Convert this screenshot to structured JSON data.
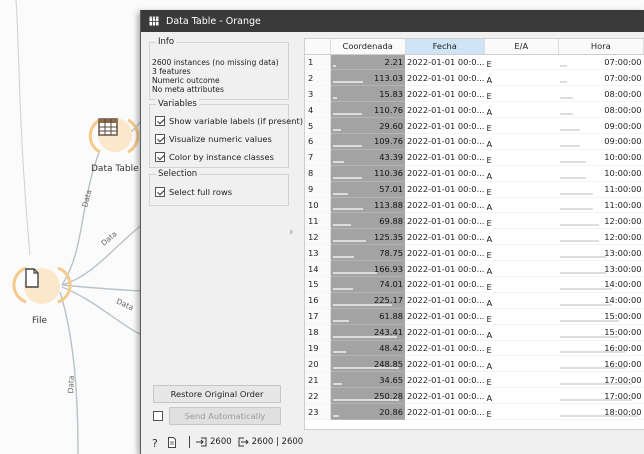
{
  "window": {
    "title": "Data Table - Orange"
  },
  "canvas": {
    "nodes": [
      {
        "label": "Data Table"
      },
      {
        "label": "File"
      }
    ],
    "link_label": "Data"
  },
  "info": {
    "title": "Info",
    "lines": [
      "2600 instances (no missing data)",
      "3 features",
      "Numeric outcome",
      "No meta attributes"
    ]
  },
  "variables": {
    "title": "Variables",
    "options": [
      {
        "label": "Show variable labels (if present)",
        "checked": true
      },
      {
        "label": "Visualize numeric values",
        "checked": true
      },
      {
        "label": "Color by instance classes",
        "checked": true
      }
    ]
  },
  "selection": {
    "title": "Selection",
    "options": [
      {
        "label": "Select full rows",
        "checked": true
      }
    ]
  },
  "buttons": {
    "restore": "Restore Original Order",
    "send": "Send Automatically",
    "send_checked": false
  },
  "status": {
    "input": "2600",
    "output": "2600 | 2600"
  },
  "table": {
    "columns": [
      "Coordenada",
      "Fecha",
      "E/A",
      "Hora"
    ],
    "sorted_column": "Fecha",
    "rows": [
      {
        "n": "1",
        "coord": "2.21",
        "cval": 2.21,
        "fecha": "2022-01-01 00:0...",
        "ea": "E",
        "hora": "07:00:00",
        "hval": 7
      },
      {
        "n": "2",
        "coord": "113.03",
        "cval": 113.03,
        "fecha": "2022-01-01 00:0...",
        "ea": "A",
        "hora": "07:00:00",
        "hval": 7
      },
      {
        "n": "3",
        "coord": "15.83",
        "cval": 15.83,
        "fecha": "2022-01-01 00:0...",
        "ea": "E",
        "hora": "08:00:00",
        "hval": 8
      },
      {
        "n": "4",
        "coord": "110.76",
        "cval": 110.76,
        "fecha": "2022-01-01 00:0...",
        "ea": "A",
        "hora": "08:00:00",
        "hval": 8
      },
      {
        "n": "5",
        "coord": "29.60",
        "cval": 29.6,
        "fecha": "2022-01-01 00:0...",
        "ea": "E",
        "hora": "09:00:00",
        "hval": 9
      },
      {
        "n": "6",
        "coord": "109.76",
        "cval": 109.76,
        "fecha": "2022-01-01 00:0...",
        "ea": "A",
        "hora": "09:00:00",
        "hval": 9
      },
      {
        "n": "7",
        "coord": "43.39",
        "cval": 43.39,
        "fecha": "2022-01-01 00:0...",
        "ea": "E",
        "hora": "10:00:00",
        "hval": 10
      },
      {
        "n": "8",
        "coord": "110.36",
        "cval": 110.36,
        "fecha": "2022-01-01 00:0...",
        "ea": "A",
        "hora": "10:00:00",
        "hval": 10
      },
      {
        "n": "9",
        "coord": "57.01",
        "cval": 57.01,
        "fecha": "2022-01-01 00:0...",
        "ea": "E",
        "hora": "11:00:00",
        "hval": 11
      },
      {
        "n": "10",
        "coord": "113.88",
        "cval": 113.88,
        "fecha": "2022-01-01 00:0...",
        "ea": "A",
        "hora": "11:00:00",
        "hval": 11
      },
      {
        "n": "11",
        "coord": "69.88",
        "cval": 69.88,
        "fecha": "2022-01-01 00:0...",
        "ea": "E",
        "hora": "12:00:00",
        "hval": 12
      },
      {
        "n": "12",
        "coord": "125.35",
        "cval": 125.35,
        "fecha": "2022-01-01 00:0...",
        "ea": "A",
        "hora": "12:00:00",
        "hval": 12
      },
      {
        "n": "13",
        "coord": "78.75",
        "cval": 78.75,
        "fecha": "2022-01-01 00:0...",
        "ea": "E",
        "hora": "13:00:00",
        "hval": 13
      },
      {
        "n": "14",
        "coord": "166.93",
        "cval": 166.93,
        "fecha": "2022-01-01 00:0...",
        "ea": "A",
        "hora": "13:00:00",
        "hval": 13
      },
      {
        "n": "15",
        "coord": "74.01",
        "cval": 74.01,
        "fecha": "2022-01-01 00:0...",
        "ea": "E",
        "hora": "14:00:00",
        "hval": 14
      },
      {
        "n": "16",
        "coord": "225.17",
        "cval": 225.17,
        "fecha": "2022-01-01 00:0...",
        "ea": "A",
        "hora": "14:00:00",
        "hval": 14
      },
      {
        "n": "17",
        "coord": "61.88",
        "cval": 61.88,
        "fecha": "2022-01-01 00:0...",
        "ea": "E",
        "hora": "15:00:00",
        "hval": 15
      },
      {
        "n": "18",
        "coord": "243.41",
        "cval": 243.41,
        "fecha": "2022-01-01 00:0...",
        "ea": "A",
        "hora": "15:00:00",
        "hval": 15
      },
      {
        "n": "19",
        "coord": "48.42",
        "cval": 48.42,
        "fecha": "2022-01-01 00:0...",
        "ea": "E",
        "hora": "16:00:00",
        "hval": 16
      },
      {
        "n": "20",
        "coord": "248.85",
        "cval": 248.85,
        "fecha": "2022-01-01 00:0...",
        "ea": "A",
        "hora": "16:00:00",
        "hval": 16
      },
      {
        "n": "21",
        "coord": "34.65",
        "cval": 34.65,
        "fecha": "2022-01-01 00:0...",
        "ea": "E",
        "hora": "17:00:00",
        "hval": 17
      },
      {
        "n": "22",
        "coord": "250.28",
        "cval": 250.28,
        "fecha": "2022-01-01 00:0...",
        "ea": "A",
        "hora": "17:00:00",
        "hval": 17
      },
      {
        "n": "23",
        "coord": "20.86",
        "cval": 20.86,
        "fecha": "2022-01-01 00:0...",
        "ea": "E",
        "hora": "18:00:00",
        "hval": 18
      }
    ]
  }
}
